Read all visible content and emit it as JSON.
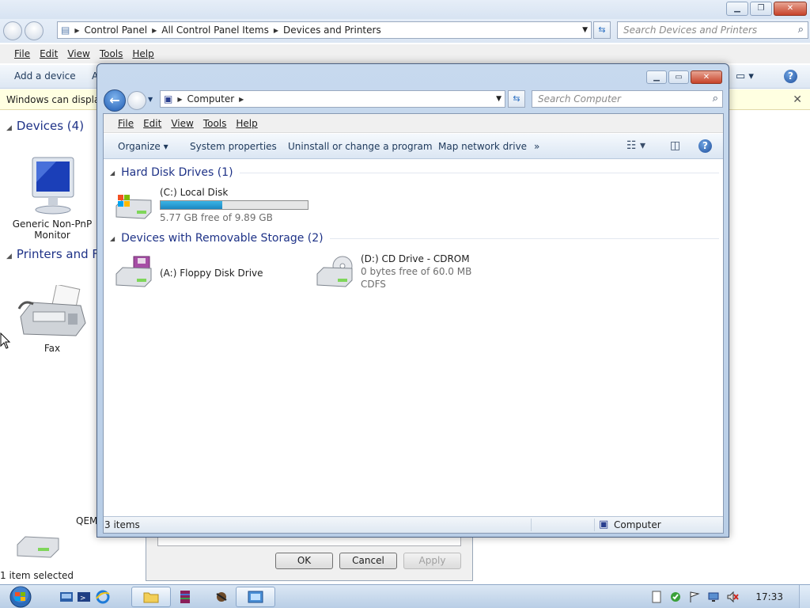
{
  "background_window": {
    "breadcrumb": [
      "Control Panel",
      "All Control Panel Items",
      "Devices and Printers"
    ],
    "search_placeholder": "Search Devices and Printers",
    "menu": [
      "File",
      "Edit",
      "View",
      "Tools",
      "Help"
    ],
    "toolbar": {
      "add_device": "Add a device",
      "partial": "A"
    },
    "infobar": "Windows can display",
    "groups": {
      "devices": "Devices (4)",
      "printers": "Printers and Fax"
    },
    "devices": [
      {
        "label_line1": "Generic Non-PnP",
        "label_line2": "Monitor",
        "icon": "monitor-icon"
      },
      {
        "label": "Fax",
        "icon": "fax-icon"
      }
    ],
    "partial_label": "QEM",
    "status": "1 item selected"
  },
  "dialog": {
    "ok": "OK",
    "cancel": "Cancel",
    "apply": "Apply"
  },
  "computer_window": {
    "address": "Computer",
    "search_placeholder": "Search Computer",
    "menu": [
      "File",
      "Edit",
      "View",
      "Tools",
      "Help"
    ],
    "commands": {
      "organize": "Organize",
      "system_properties": "System properties",
      "uninstall": "Uninstall or change a program",
      "map_drive": "Map network drive",
      "more": "»"
    },
    "groups": {
      "hdd": "Hard Disk Drives (1)",
      "removable": "Devices with Removable Storage (2)"
    },
    "drives": {
      "c": {
        "name": "(C:) Local Disk",
        "free": "5.77 GB free of 9.89 GB",
        "used_fraction": 0.42
      },
      "a": {
        "name": "(A:) Floppy Disk Drive"
      },
      "d": {
        "name": "(D:) CD Drive - CDROM",
        "free": "0 bytes free of 60.0 MB",
        "fs": "CDFS"
      }
    },
    "status": {
      "items": "3 items",
      "location": "Computer"
    }
  },
  "taskbar": {
    "clock": "17:33"
  },
  "colors": {
    "accent_blue": "#1e3287",
    "bar_fill": "#26a0da",
    "title_gradient": "#c7d9ee"
  }
}
